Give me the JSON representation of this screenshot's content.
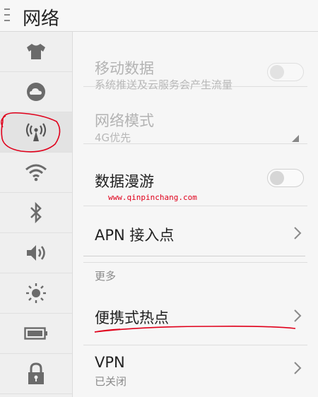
{
  "header": {
    "title": "网络"
  },
  "sidebar": {
    "items": [
      {
        "icon": "theme-shirt-icon"
      },
      {
        "icon": "cloud-icon"
      },
      {
        "icon": "cellular-antenna-icon"
      },
      {
        "icon": "wifi-icon"
      },
      {
        "icon": "bluetooth-icon"
      },
      {
        "icon": "volume-icon"
      },
      {
        "icon": "brightness-icon"
      },
      {
        "icon": "battery-icon"
      },
      {
        "icon": "lock-icon"
      }
    ],
    "active_index": 2
  },
  "settings": {
    "mobile_data": {
      "title": "移动数据",
      "subtitle": "系统推送及云服务会产生流量",
      "enabled": false,
      "on": false
    },
    "network_mode": {
      "title": "网络模式",
      "value": "4G优先",
      "enabled": false
    },
    "data_roaming": {
      "title": "数据漫游",
      "on": false
    },
    "apn": {
      "title": "APN 接入点"
    },
    "section_more": "更多",
    "hotspot": {
      "title": "便携式热点"
    },
    "vpn": {
      "title": "VPN",
      "subtitle": "已关闭"
    }
  },
  "watermark": "www.qinpinchang.com",
  "colors": {
    "annotation": "#e0001b",
    "disabled_text": "#b3b3b3"
  }
}
